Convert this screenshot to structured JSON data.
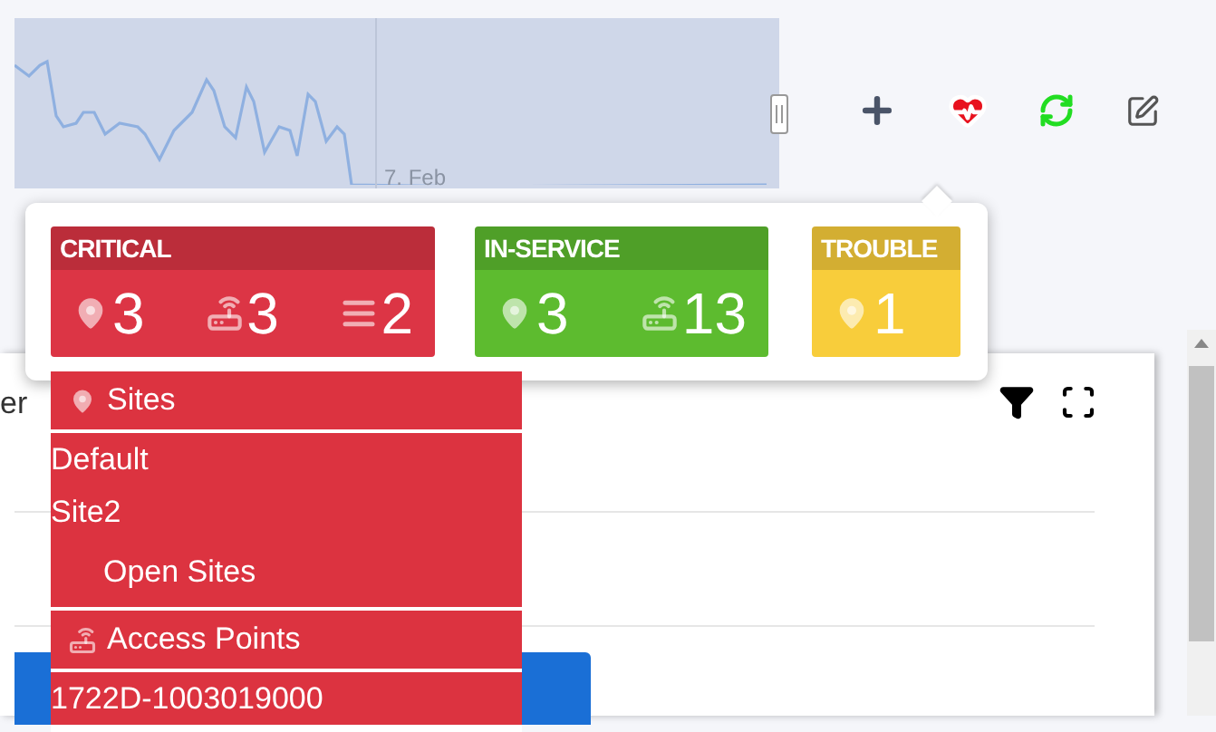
{
  "navigator": {
    "date_label": "7. Feb"
  },
  "toolbar": [
    {
      "kind": "add"
    },
    {
      "kind": "health"
    },
    {
      "kind": "refresh"
    },
    {
      "kind": "edit"
    }
  ],
  "status_popup": {
    "groups": [
      {
        "title": "CRITICAL",
        "color": "#dc3545",
        "counts": [
          {
            "kind": "site",
            "value": "3"
          },
          {
            "kind": "access-point",
            "value": "3"
          },
          {
            "kind": "list",
            "value": "2"
          }
        ]
      },
      {
        "title": "IN-SERVICE",
        "color": "#5dbb2f",
        "counts": [
          {
            "kind": "site",
            "value": "3"
          },
          {
            "kind": "access-point",
            "value": "13"
          }
        ]
      },
      {
        "title": "TROUBLE",
        "color": "#f8cd3b",
        "counts": [
          {
            "kind": "site",
            "value": "1"
          }
        ]
      }
    ]
  },
  "dropdown": {
    "sections": [
      {
        "kind": "site",
        "title": "Sites",
        "items": [
          "Default",
          "Site2"
        ],
        "action": "Open Sites"
      },
      {
        "kind": "access-point",
        "title": "Access Points",
        "items": [
          "1722D-1003019000"
        ]
      }
    ]
  },
  "panel": {
    "title_fragment": "er"
  }
}
